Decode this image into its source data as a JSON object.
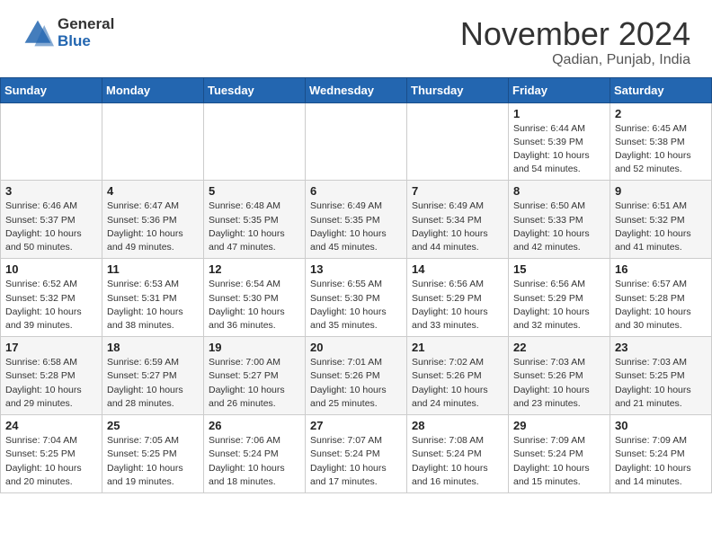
{
  "header": {
    "logo_general": "General",
    "logo_blue": "Blue",
    "month_title": "November 2024",
    "location": "Qadian, Punjab, India"
  },
  "weekdays": [
    "Sunday",
    "Monday",
    "Tuesday",
    "Wednesday",
    "Thursday",
    "Friday",
    "Saturday"
  ],
  "weeks": [
    [
      {
        "day": "",
        "info": ""
      },
      {
        "day": "",
        "info": ""
      },
      {
        "day": "",
        "info": ""
      },
      {
        "day": "",
        "info": ""
      },
      {
        "day": "",
        "info": ""
      },
      {
        "day": "1",
        "info": "Sunrise: 6:44 AM\nSunset: 5:39 PM\nDaylight: 10 hours\nand 54 minutes."
      },
      {
        "day": "2",
        "info": "Sunrise: 6:45 AM\nSunset: 5:38 PM\nDaylight: 10 hours\nand 52 minutes."
      }
    ],
    [
      {
        "day": "3",
        "info": "Sunrise: 6:46 AM\nSunset: 5:37 PM\nDaylight: 10 hours\nand 50 minutes."
      },
      {
        "day": "4",
        "info": "Sunrise: 6:47 AM\nSunset: 5:36 PM\nDaylight: 10 hours\nand 49 minutes."
      },
      {
        "day": "5",
        "info": "Sunrise: 6:48 AM\nSunset: 5:35 PM\nDaylight: 10 hours\nand 47 minutes."
      },
      {
        "day": "6",
        "info": "Sunrise: 6:49 AM\nSunset: 5:35 PM\nDaylight: 10 hours\nand 45 minutes."
      },
      {
        "day": "7",
        "info": "Sunrise: 6:49 AM\nSunset: 5:34 PM\nDaylight: 10 hours\nand 44 minutes."
      },
      {
        "day": "8",
        "info": "Sunrise: 6:50 AM\nSunset: 5:33 PM\nDaylight: 10 hours\nand 42 minutes."
      },
      {
        "day": "9",
        "info": "Sunrise: 6:51 AM\nSunset: 5:32 PM\nDaylight: 10 hours\nand 41 minutes."
      }
    ],
    [
      {
        "day": "10",
        "info": "Sunrise: 6:52 AM\nSunset: 5:32 PM\nDaylight: 10 hours\nand 39 minutes."
      },
      {
        "day": "11",
        "info": "Sunrise: 6:53 AM\nSunset: 5:31 PM\nDaylight: 10 hours\nand 38 minutes."
      },
      {
        "day": "12",
        "info": "Sunrise: 6:54 AM\nSunset: 5:30 PM\nDaylight: 10 hours\nand 36 minutes."
      },
      {
        "day": "13",
        "info": "Sunrise: 6:55 AM\nSunset: 5:30 PM\nDaylight: 10 hours\nand 35 minutes."
      },
      {
        "day": "14",
        "info": "Sunrise: 6:56 AM\nSunset: 5:29 PM\nDaylight: 10 hours\nand 33 minutes."
      },
      {
        "day": "15",
        "info": "Sunrise: 6:56 AM\nSunset: 5:29 PM\nDaylight: 10 hours\nand 32 minutes."
      },
      {
        "day": "16",
        "info": "Sunrise: 6:57 AM\nSunset: 5:28 PM\nDaylight: 10 hours\nand 30 minutes."
      }
    ],
    [
      {
        "day": "17",
        "info": "Sunrise: 6:58 AM\nSunset: 5:28 PM\nDaylight: 10 hours\nand 29 minutes."
      },
      {
        "day": "18",
        "info": "Sunrise: 6:59 AM\nSunset: 5:27 PM\nDaylight: 10 hours\nand 28 minutes."
      },
      {
        "day": "19",
        "info": "Sunrise: 7:00 AM\nSunset: 5:27 PM\nDaylight: 10 hours\nand 26 minutes."
      },
      {
        "day": "20",
        "info": "Sunrise: 7:01 AM\nSunset: 5:26 PM\nDaylight: 10 hours\nand 25 minutes."
      },
      {
        "day": "21",
        "info": "Sunrise: 7:02 AM\nSunset: 5:26 PM\nDaylight: 10 hours\nand 24 minutes."
      },
      {
        "day": "22",
        "info": "Sunrise: 7:03 AM\nSunset: 5:26 PM\nDaylight: 10 hours\nand 23 minutes."
      },
      {
        "day": "23",
        "info": "Sunrise: 7:03 AM\nSunset: 5:25 PM\nDaylight: 10 hours\nand 21 minutes."
      }
    ],
    [
      {
        "day": "24",
        "info": "Sunrise: 7:04 AM\nSunset: 5:25 PM\nDaylight: 10 hours\nand 20 minutes."
      },
      {
        "day": "25",
        "info": "Sunrise: 7:05 AM\nSunset: 5:25 PM\nDaylight: 10 hours\nand 19 minutes."
      },
      {
        "day": "26",
        "info": "Sunrise: 7:06 AM\nSunset: 5:24 PM\nDaylight: 10 hours\nand 18 minutes."
      },
      {
        "day": "27",
        "info": "Sunrise: 7:07 AM\nSunset: 5:24 PM\nDaylight: 10 hours\nand 17 minutes."
      },
      {
        "day": "28",
        "info": "Sunrise: 7:08 AM\nSunset: 5:24 PM\nDaylight: 10 hours\nand 16 minutes."
      },
      {
        "day": "29",
        "info": "Sunrise: 7:09 AM\nSunset: 5:24 PM\nDaylight: 10 hours\nand 15 minutes."
      },
      {
        "day": "30",
        "info": "Sunrise: 7:09 AM\nSunset: 5:24 PM\nDaylight: 10 hours\nand 14 minutes."
      }
    ]
  ]
}
